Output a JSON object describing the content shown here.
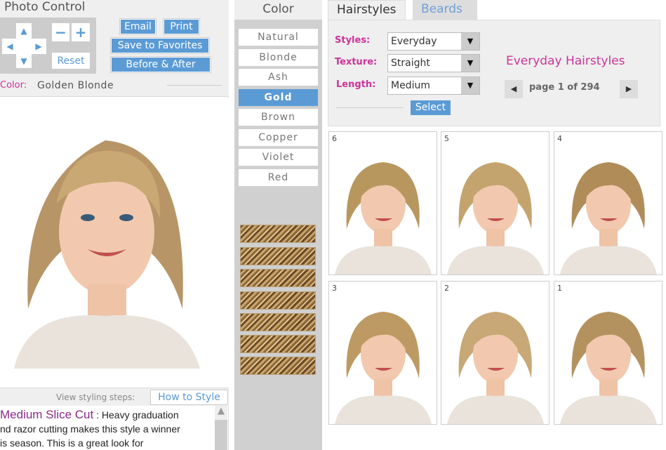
{
  "photo_control": {
    "title": "Photo Control",
    "zoom_out": "−",
    "zoom_in": "+",
    "reset": "Reset",
    "email": "Email",
    "print": "Print",
    "save": "Save to Favorites",
    "before_after": "Before & After",
    "color_label": "Color:",
    "color_value": "Golden Blonde"
  },
  "styling": {
    "label": "View styling steps:",
    "link": "How to Style"
  },
  "description": {
    "name": "Medium Slice Cut",
    "sep": " : ",
    "lines": [
      "Heavy graduation",
      "nd razor cutting makes this style a winner",
      "is season. This is a great look for"
    ]
  },
  "color": {
    "header": "Color",
    "options": [
      "Natural",
      "Blonde",
      "Ash",
      "Gold",
      "Brown",
      "Copper",
      "Violet",
      "Red"
    ],
    "selected": "Gold",
    "accent": "#5b9bd5"
  },
  "tabs": [
    {
      "label": "Hairstyles",
      "active": true
    },
    {
      "label": "Beards",
      "active": false
    }
  ],
  "filters": {
    "styles_label": "Styles:",
    "styles": "Everyday",
    "texture_label": "Texture:",
    "texture": "Straight",
    "length_label": "Length:",
    "length": "Medium",
    "select": "Select"
  },
  "results": {
    "heading": "Everyday Hairstyles",
    "page": "page 1 of 294",
    "thumbnails": [
      "6",
      "5",
      "4",
      "3",
      "2",
      "1"
    ]
  }
}
